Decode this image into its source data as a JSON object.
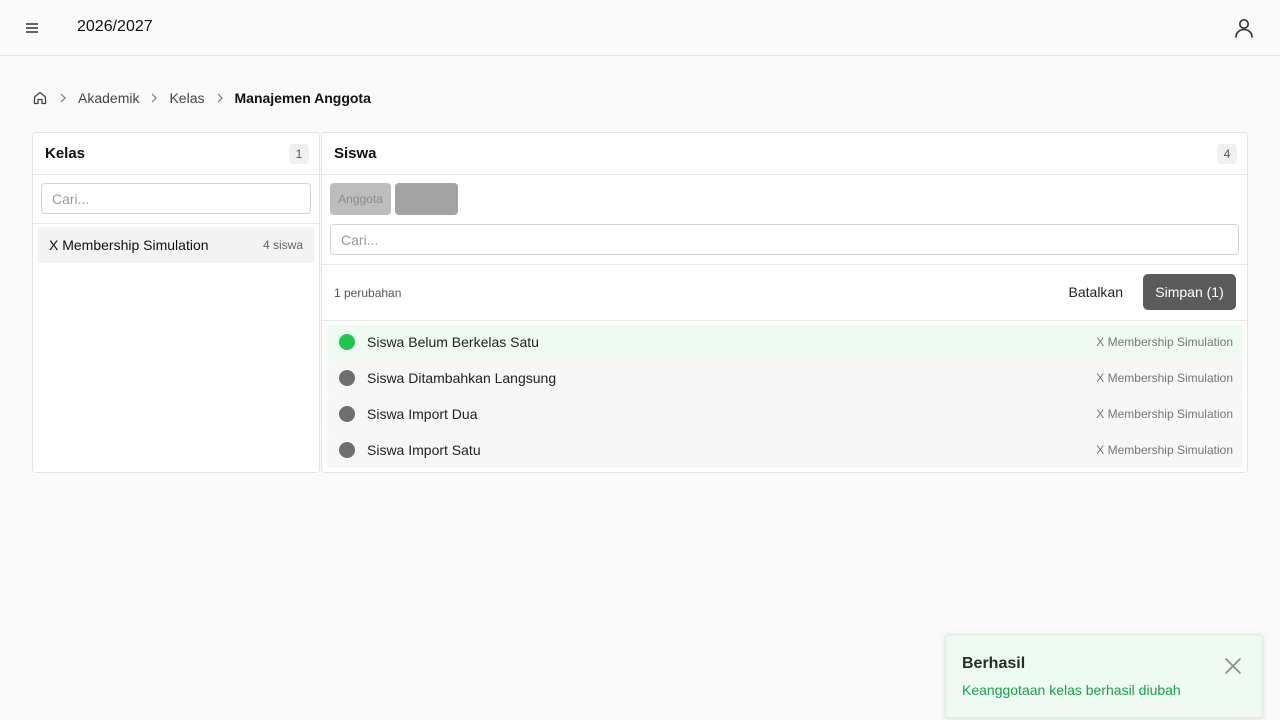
{
  "header": {
    "year": "2026/2027",
    "menu_icon": "hamburger-icon",
    "user_icon": "user-icon"
  },
  "breadcrumb": {
    "home_icon": "home-icon",
    "items": [
      "Akademik",
      "Kelas"
    ],
    "current": "Manajemen Anggota"
  },
  "left_panel": {
    "title": "Kelas",
    "count": "1",
    "search_placeholder": "Cari...",
    "items": [
      {
        "name": "X Membership Simulation",
        "count": "4 siswa"
      }
    ]
  },
  "right_panel": {
    "title": "Siswa",
    "count": "4",
    "tabs": [
      "Anggota",
      ""
    ],
    "search_placeholder": "Cari...",
    "changes_text": "1 perubahan",
    "cancel_label": "Batalkan",
    "save_label": "Simpan (1)",
    "students": [
      {
        "name": "Siswa Belum Berkelas Satu",
        "class": "X Membership Simulation",
        "status": "added"
      },
      {
        "name": "Siswa Ditambahkan Langsung",
        "class": "X Membership Simulation",
        "status": "member"
      },
      {
        "name": "Siswa Import Dua",
        "class": "X Membership Simulation",
        "status": "member"
      },
      {
        "name": "Siswa Import Satu",
        "class": "X Membership Simulation",
        "status": "member"
      }
    ]
  },
  "toast": {
    "title": "Berhasil",
    "message": "Keanggotaan kelas berhasil diubah",
    "close_icon": "close-icon"
  },
  "colors": {
    "added_dot": "#1cc74e",
    "member_dot": "#6f6f6f",
    "save_button": "#5b5b5b",
    "toast_text": "#17a34a"
  }
}
